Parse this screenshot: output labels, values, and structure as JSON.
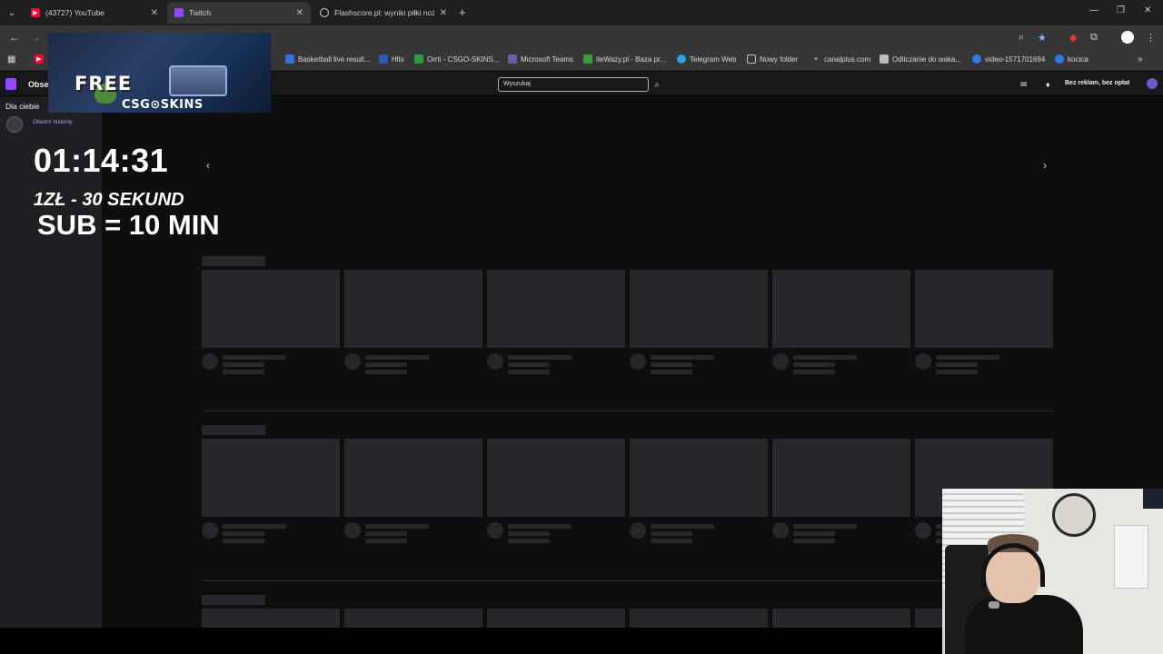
{
  "browser": {
    "tabs": [
      {
        "label": "(43727) YouTube",
        "favicon_color": "#ff0033",
        "active": false
      },
      {
        "label": "Twitch",
        "favicon_color": "#9147ff",
        "active": true
      },
      {
        "label": "Flashscore.pl: wyniki piłki nożne",
        "favicon_color": "#d0d0d0",
        "active": false
      }
    ],
    "new_tab": "+",
    "window_controls": {
      "minimize": "—",
      "restore": "❐",
      "close": "✕"
    },
    "bookmarks": [
      {
        "label": "Basketball live result...",
        "icon_color": "#3a6fd8"
      },
      {
        "label": "Hltv",
        "icon_color": "#2a5bb0"
      },
      {
        "label": "Orrti - CSGO-SKINS...",
        "icon_color": "#2f9a3c"
      },
      {
        "label": "Microsoft Teams",
        "icon_color": "#6264a7"
      },
      {
        "label": "IleWazy.pl - Baza pr...",
        "icon_color": "#3e9b3a"
      },
      {
        "label": "Telegram Web",
        "icon_color": "#2aa3df"
      },
      {
        "label": "Nowy folder",
        "icon_color": "#6f6f6f"
      },
      {
        "label": "canalplus.com",
        "icon_color": "#7a7a7a"
      },
      {
        "label": "Odliczanie do waka...",
        "icon_color": "#bdbdbd"
      },
      {
        "label": "video-1571701694",
        "icon_color": "#2d7be5"
      },
      {
        "label": "kocica",
        "icon_color": "#2d7be5"
      }
    ]
  },
  "twitch": {
    "nav_label": "Obse",
    "search_placeholder": "Wyszukaj",
    "prime_label": "Bez reklam, bez opłat",
    "sidebar_title": "Dla ciebie",
    "history_link": "Otwórz historię",
    "accent": "#9147ff"
  },
  "overlay": {
    "ad_free": "FREE",
    "ad_brand": "CSG⊙SKINS",
    "timer": "01:14:31",
    "rate": "1ZŁ - 30 SEKUND",
    "sub": "SUB = 10 MIN"
  }
}
